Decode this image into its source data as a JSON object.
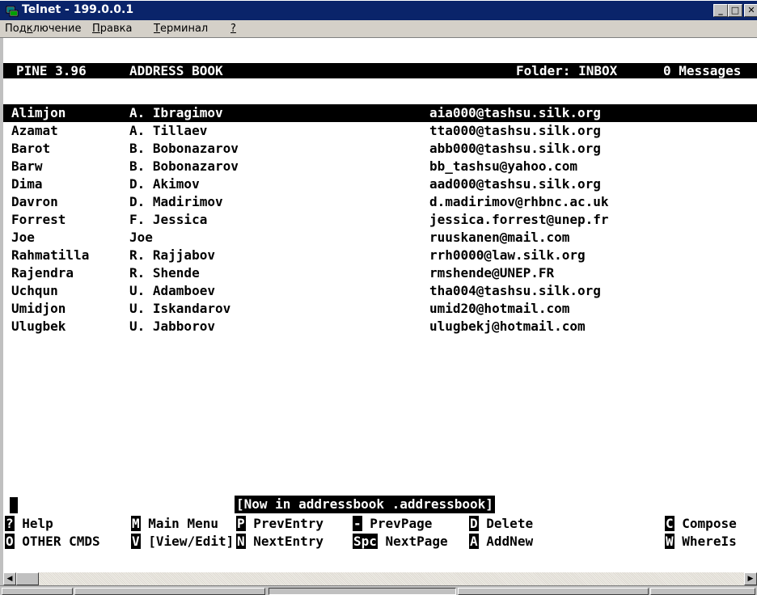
{
  "window": {
    "title": "Telnet - 199.0.0.1",
    "minimize": "_",
    "maximize": "□",
    "close": "✕"
  },
  "menu": {
    "items": [
      {
        "label": "Подключение"
      },
      {
        "label": "Правка"
      },
      {
        "label": "Терминал"
      },
      {
        "label": "?"
      }
    ]
  },
  "header": {
    "app": "PINE 3.96",
    "screen": "ADDRESS BOOK",
    "folder": "Folder: INBOX",
    "messages": "0 Messages"
  },
  "entries": [
    {
      "nick": "Alimjon",
      "name": "A. Ibragimov",
      "address": "aia000@tashsu.silk.org",
      "selected": true
    },
    {
      "nick": "Azamat",
      "name": "A. Tillaev",
      "address": "tta000@tashsu.silk.org"
    },
    {
      "nick": "Barot",
      "name": "B. Bobonazarov",
      "address": "abb000@tashsu.silk.org"
    },
    {
      "nick": "Barw",
      "name": "B. Bobonazarov",
      "address": "bb_tashsu@yahoo.com"
    },
    {
      "nick": "Dima",
      "name": "D. Akimov",
      "address": "aad000@tashsu.silk.org"
    },
    {
      "nick": "Davron",
      "name": "D. Madirimov",
      "address": "d.madirimov@rhbnc.ac.uk"
    },
    {
      "nick": "Forrest",
      "name": "F. Jessica",
      "address": "jessica.forrest@unep.fr"
    },
    {
      "nick": "Joe",
      "name": "Joe",
      "address": "ruuskanen@mail.com"
    },
    {
      "nick": "Rahmatilla",
      "name": "R. Rajjabov",
      "address": "rrh0000@law.silk.org"
    },
    {
      "nick": "Rajendra",
      "name": "R. Shende",
      "address": "rmshende@UNEP.FR"
    },
    {
      "nick": "Uchqun",
      "name": "U. Adamboev",
      "address": "tha004@tashsu.silk.org"
    },
    {
      "nick": "Umidjon",
      "name": "U. Iskandarov",
      "address": "umid20@hotmail.com"
    },
    {
      "nick": "Ulugbek",
      "name": "U. Jabborov",
      "address": "ulugbekj@hotmail.com"
    }
  ],
  "status_message": "[Now in addressbook .addressbook]",
  "commands_row1": [
    {
      "key": "?",
      "label": "Help"
    },
    {
      "key": "M",
      "label": "Main Menu"
    },
    {
      "key": "P",
      "label": "PrevEntry"
    },
    {
      "key": "-",
      "label": "PrevPage"
    },
    {
      "key": "D",
      "label": "Delete"
    },
    {
      "key": "C",
      "label": "Compose"
    }
  ],
  "commands_row2": [
    {
      "key": "O",
      "label": "OTHER CMDS"
    },
    {
      "key": "V",
      "label": "[View/Edit]"
    },
    {
      "key": "N",
      "label": "NextEntry"
    },
    {
      "key": "Spc",
      "label": "NextPage"
    },
    {
      "key": "A",
      "label": "AddNew"
    },
    {
      "key": "W",
      "label": "WhereIs"
    }
  ]
}
